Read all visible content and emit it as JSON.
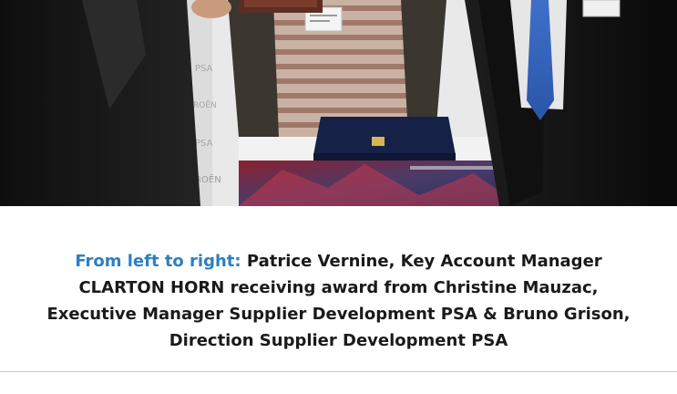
{
  "caption": {
    "lead": "From left to right:",
    "text": "Patrice Vernine, Key Account Manager CLARTON HORN receiving award from Christine Mauzac, Executive Manager Supplier Development PSA & Bruno Grison, Direction Supplier Development PSA"
  },
  "photo": {
    "banner_text_left": "PSA",
    "banner_text_left_2": "ROËN",
    "banner_text_left_3": "PSA",
    "banner_text_left_4": "TROËN"
  },
  "colors": {
    "caption_lead": "#2e7fc1",
    "caption_text": "#1a1a1a",
    "rule": "#c8c8c8"
  }
}
